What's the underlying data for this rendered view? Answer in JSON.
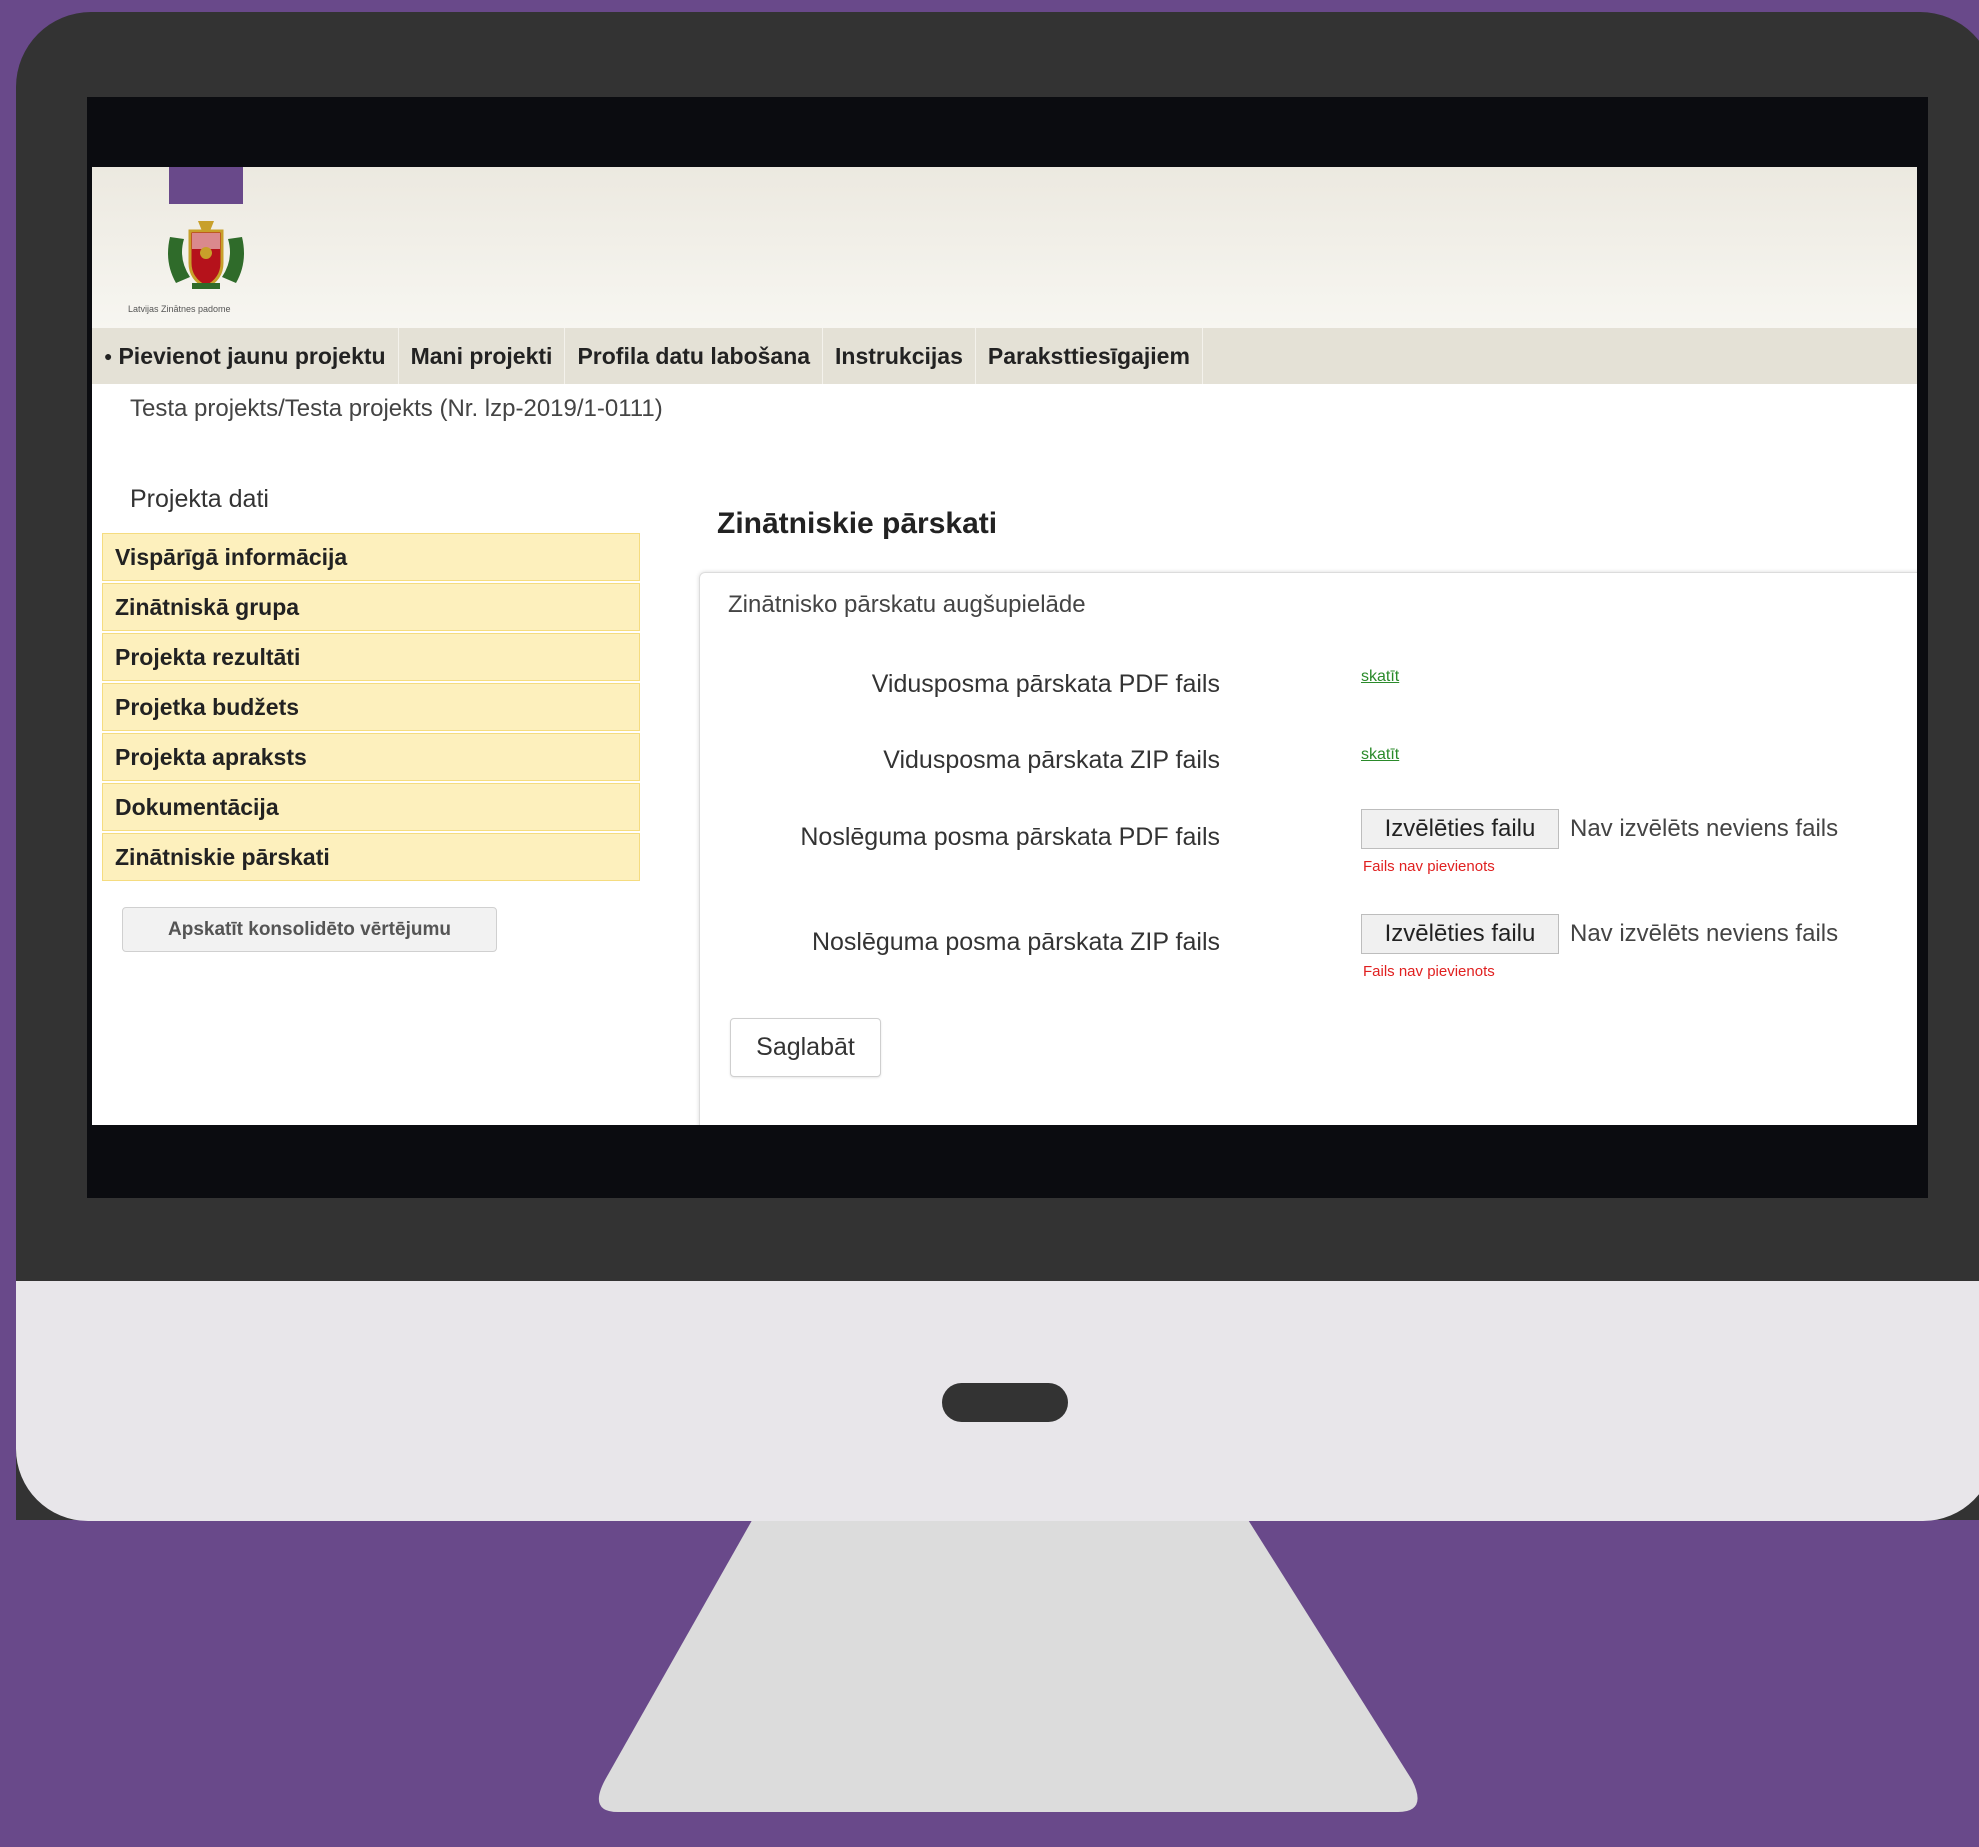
{
  "colors": {
    "background": "#69498a",
    "monitor_frame": "#333333",
    "monitor_chin": "#e8e6ea",
    "stand": "#dcdcdc",
    "sidebar_item_bg": "#fdf0bd",
    "link": "#2a8a2a",
    "error": "#e02020"
  },
  "header": {
    "logo_caption": "Latvijas Zinātnes padome"
  },
  "nav": {
    "items": [
      {
        "label": "Pievienot jaunu projektu",
        "icon": "bullet-icon"
      },
      {
        "label": "Mani projekti"
      },
      {
        "label": "Profila datu labošana"
      },
      {
        "label": "Instrukcijas"
      },
      {
        "label": "Paraksttiesīgajiem"
      }
    ]
  },
  "breadcrumb": "Testa projekts/Testa projekts (Nr. lzp-2019/1-0111)",
  "sidebar": {
    "title": "Projekta dati",
    "items": [
      {
        "label": "Vispārīgā informācija"
      },
      {
        "label": "Zinātniskā grupa"
      },
      {
        "label": "Projekta rezultāti"
      },
      {
        "label": "Projetka budžets"
      },
      {
        "label": "Projekta apraksts"
      },
      {
        "label": "Dokumentācija"
      },
      {
        "label": "Zinātniskie pārskati"
      }
    ],
    "button": "Apskatīt konsolidēto vērtējumu"
  },
  "main": {
    "title": "Zinātniskie pārskati",
    "panel_title": "Zinātnisko pārskatu augšupielāde",
    "rows": [
      {
        "label": "Vidusposma pārskata PDF fails",
        "link": "skatīt"
      },
      {
        "label": "Vidusposma pārskata ZIP fails",
        "link": "skatīt"
      },
      {
        "label": "Noslēguma posma pārskata PDF fails",
        "button": "Izvēlēties failu",
        "status": "Nav izvēlēts neviens fails",
        "error": "Fails nav pievienots"
      },
      {
        "label": "Noslēguma posma pārskata ZIP fails",
        "button": "Izvēlēties failu",
        "status": "Nav izvēlēts neviens fails",
        "error": "Fails nav pievienots"
      }
    ],
    "save_label": "Saglabāt"
  }
}
